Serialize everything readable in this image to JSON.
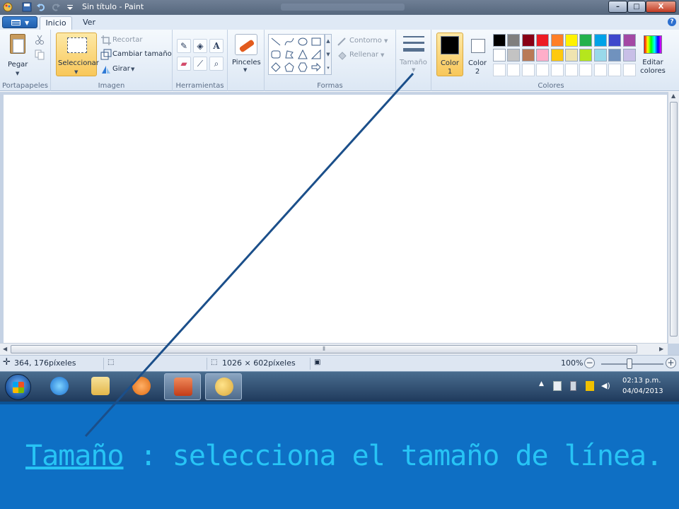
{
  "window": {
    "title": "Sin título - Paint",
    "controls": {
      "minimize": "–",
      "maximize": "□",
      "close": "X"
    }
  },
  "ribbon": {
    "tabs": [
      {
        "label": "Inicio",
        "selected": true
      },
      {
        "label": "Ver",
        "selected": false
      }
    ],
    "help_icon": "?",
    "groups": {
      "portapapeles": {
        "label": "Portapapeles",
        "pegar": "Pegar"
      },
      "imagen": {
        "label": "Imagen",
        "seleccionar": "Seleccionar",
        "recortar": "Recortar",
        "cambiar_tamano": "Cambiar tamaño",
        "girar": "Girar"
      },
      "herramientas": {
        "label": "Herramientas",
        "text_tool": "A"
      },
      "pinceles": {
        "label": "Pinceles"
      },
      "formas": {
        "label": "Formas",
        "contorno": "Contorno",
        "rellenar": "Rellenar"
      },
      "tamano": {
        "label": "Tamaño"
      },
      "colores": {
        "label": "Colores",
        "color1_line1": "Color",
        "color1_line2": "1",
        "color2_line1": "Color",
        "color2_line2": "2",
        "editar_line1": "Editar",
        "editar_line2": "colores",
        "color1": "#000000",
        "color2": "#ffffff",
        "palette_row1": [
          "#000000",
          "#7f7f7f",
          "#880015",
          "#ed1c24",
          "#ff7f27",
          "#fff200",
          "#22b14c",
          "#00a2e8",
          "#3f48cc",
          "#a349a4"
        ],
        "palette_row2": [
          "#ffffff",
          "#c3c3c3",
          "#b97a57",
          "#ffaec9",
          "#ffc90e",
          "#efe4b0",
          "#b5e61d",
          "#99d9ea",
          "#7092be",
          "#c8bfe7"
        ],
        "palette_row3": [
          "#ffffff",
          "#ffffff",
          "#ffffff",
          "#ffffff",
          "#ffffff",
          "#ffffff",
          "#ffffff",
          "#ffffff",
          "#ffffff",
          "#ffffff"
        ]
      }
    }
  },
  "statusbar": {
    "cursor_position": "364, 176píxeles",
    "canvas_size": "1026 × 602píxeles",
    "zoom": "100%",
    "zoom_minus": "−",
    "zoom_plus": "+"
  },
  "taskbar": {
    "apps": [
      "internet-explorer",
      "file-explorer",
      "media-player",
      "powerpoint",
      "paint"
    ],
    "active_apps": [
      "powerpoint",
      "paint"
    ],
    "time": "02:13 p.m.",
    "date": "04/04/2013"
  },
  "caption": {
    "term": "Tamaño",
    "separator": " : ",
    "description": "selecciona el tamaño de línea."
  },
  "colors": {
    "caption_background": "#0e6fc4",
    "caption_text": "#27c4f5",
    "pointer_line": "#1b4f8a",
    "selected_tool_highlight": "#f8c75a"
  }
}
